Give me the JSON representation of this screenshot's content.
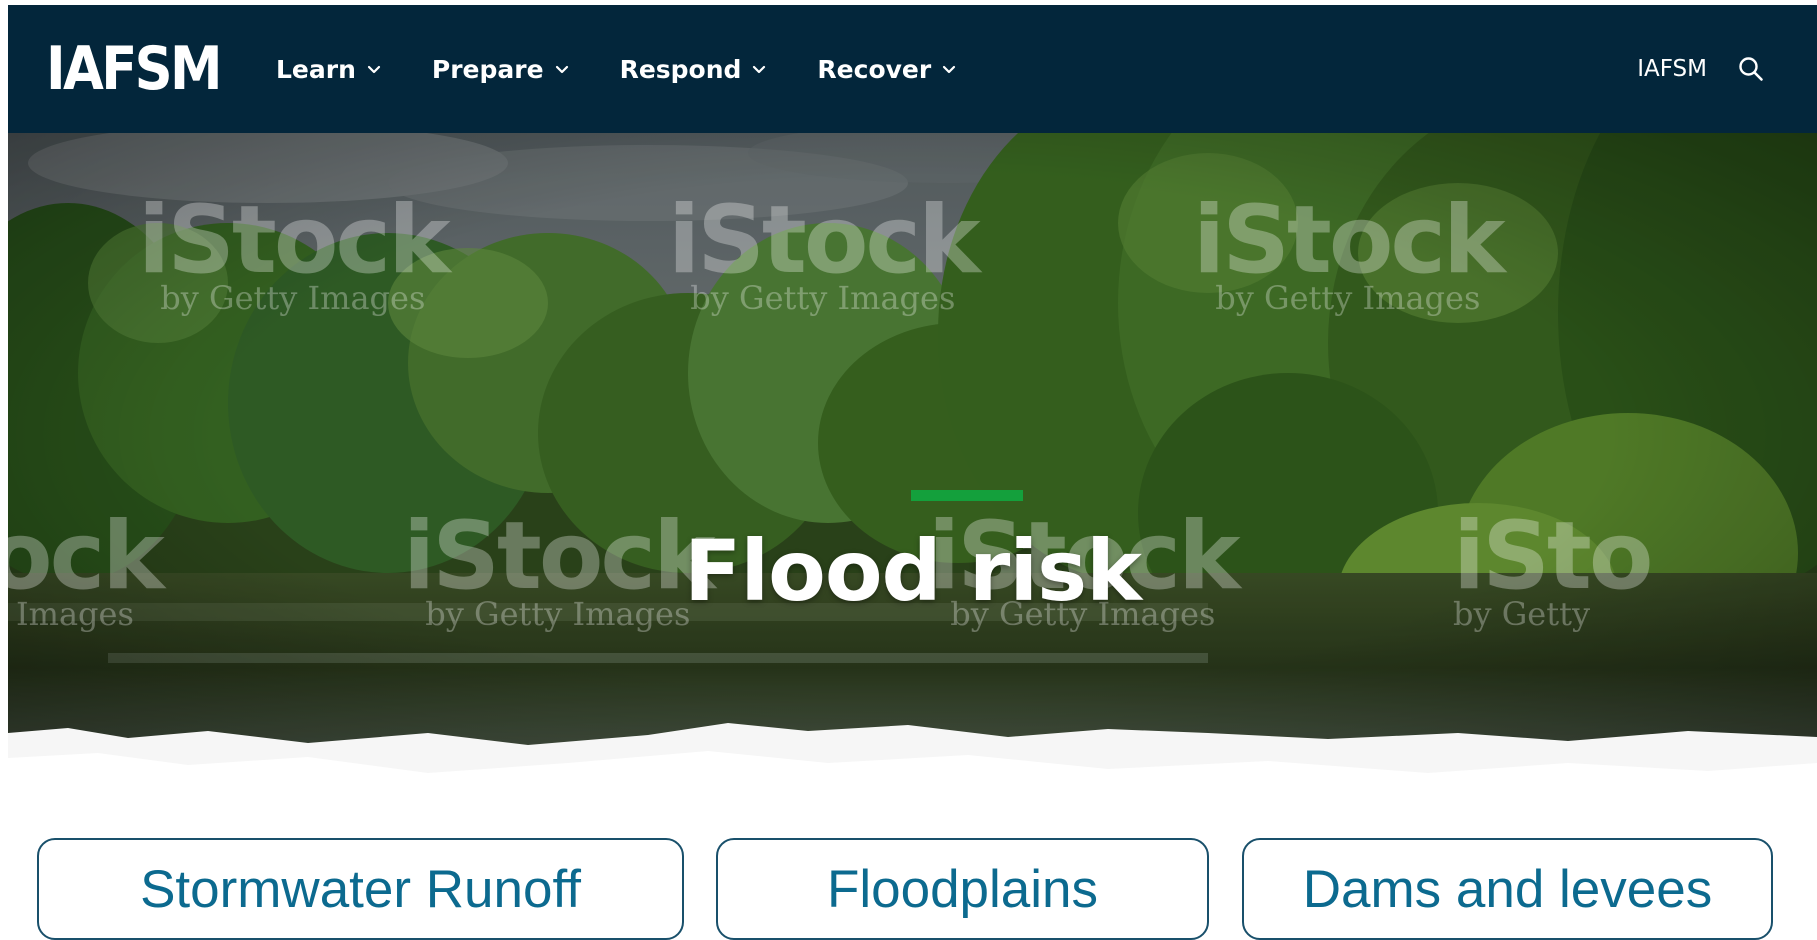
{
  "header": {
    "logo_text": "IAFSM",
    "nav": [
      {
        "label": "Learn"
      },
      {
        "label": "Prepare"
      },
      {
        "label": "Respond"
      },
      {
        "label": "Recover"
      }
    ],
    "org_link": "IAFSM",
    "search_icon": "search-icon",
    "dropdown_icon": "chevron-down-icon"
  },
  "hero": {
    "title": "Flood risk",
    "accent_color": "#14a03c",
    "watermarks": [
      {
        "main": "iStock",
        "sub": "by Getty Images"
      },
      {
        "main": "iStock",
        "sub": "by Getty Images"
      },
      {
        "main": "iStock",
        "sub": "by Getty Images"
      },
      {
        "main": "ock",
        "sub": "Images"
      },
      {
        "main": "iStock",
        "sub": "by Getty Images"
      },
      {
        "main": "iStock",
        "sub": "by Getty Images"
      },
      {
        "main": "iSto",
        "sub": "by Getty"
      }
    ]
  },
  "topics": [
    {
      "label": "Stormwater Runoff"
    },
    {
      "label": "Floodplains"
    },
    {
      "label": "Dams and levees"
    }
  ],
  "colors": {
    "navbar": "#03263b",
    "topic_border": "#19506b",
    "topic_text": "#0c6a8f"
  }
}
